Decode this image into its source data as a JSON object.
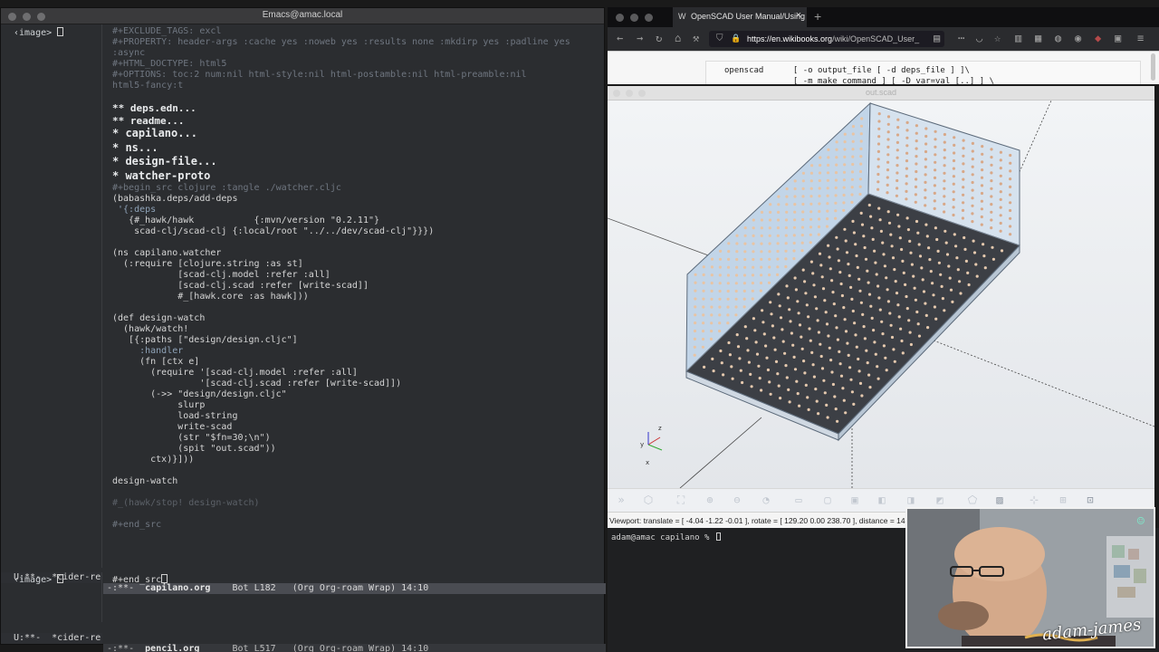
{
  "emacs": {
    "title": "Emacs@amac.local",
    "left_prompt": "‹image>",
    "lower_left_prompt": "‹image>",
    "code_lines": [
      {
        "t": "#+EXCLUDE_TAGS: excl",
        "c": "c-com"
      },
      {
        "t": "#+PROPERTY: header-args :cache yes :noweb yes :results none :mkdirp yes :padline yes",
        "c": "c-com"
      },
      {
        "t": ":async",
        "c": "c-com"
      },
      {
        "t": "#+HTML_DOCTYPE: html5",
        "c": "c-com"
      },
      {
        "t": "#+OPTIONS: toc:2 num:nil html-style:nil html-postamble:nil html-preamble:nil",
        "c": "c-com"
      },
      {
        "t": "html5-fancy:t",
        "c": "c-com"
      },
      {
        "t": "",
        "c": ""
      },
      {
        "t": "** deps.edn...",
        "c": "c-head2"
      },
      {
        "t": "** readme...",
        "c": "c-head2"
      },
      {
        "t": "* capilano...",
        "c": "c-head"
      },
      {
        "t": "* ns...",
        "c": "c-head"
      },
      {
        "t": "* design-file...",
        "c": "c-head"
      },
      {
        "t": "* watcher-proto",
        "c": "c-head"
      },
      {
        "t": "#+begin_src clojure :tangle ./watcher.cljc",
        "c": "c-com"
      },
      {
        "t": "(babashka.deps/add-deps",
        "c": ""
      },
      {
        "t": " '{:deps",
        "c": "c-kw"
      },
      {
        "t": "   {#_hawk/hawk           {:mvn/version \"0.2.11\"}",
        "c": ""
      },
      {
        "t": "    scad-clj/scad-clj {:local/root \"../../dev/scad-clj\"}}})",
        "c": ""
      },
      {
        "t": "",
        "c": ""
      },
      {
        "t": "(ns capilano.watcher",
        "c": ""
      },
      {
        "t": "  (:require [clojure.string :as st]",
        "c": ""
      },
      {
        "t": "            [scad-clj.model :refer :all]",
        "c": ""
      },
      {
        "t": "            [scad-clj.scad :refer [write-scad]]",
        "c": ""
      },
      {
        "t": "            #_[hawk.core :as hawk]))",
        "c": ""
      },
      {
        "t": "",
        "c": ""
      },
      {
        "t": "(def design-watch",
        "c": ""
      },
      {
        "t": "  (hawk/watch!",
        "c": ""
      },
      {
        "t": "   [{:paths [\"design/design.cljc\"]",
        "c": ""
      },
      {
        "t": "     :handler",
        "c": "c-kw"
      },
      {
        "t": "     (fn [ctx e]",
        "c": ""
      },
      {
        "t": "       (require '[scad-clj.model :refer :all]",
        "c": ""
      },
      {
        "t": "                '[scad-clj.scad :refer [write-scad]])",
        "c": ""
      },
      {
        "t": "       (->> \"design/design.cljc\"",
        "c": ""
      },
      {
        "t": "            slurp",
        "c": ""
      },
      {
        "t": "            load-string",
        "c": ""
      },
      {
        "t": "            write-scad",
        "c": ""
      },
      {
        "t": "            (str \"$fn=30;\\n\")",
        "c": ""
      },
      {
        "t": "            (spit \"out.scad\"))",
        "c": ""
      },
      {
        "t": "       ctx)}]))",
        "c": ""
      },
      {
        "t": "",
        "c": ""
      },
      {
        "t": "design-watch",
        "c": ""
      },
      {
        "t": "",
        "c": ""
      },
      {
        "t": "#_(hawk/stop! design-watch)",
        "c": "c-dim"
      },
      {
        "t": "",
        "c": ""
      },
      {
        "t": "#+end_src",
        "c": "c-com"
      }
    ],
    "modeline1": {
      "left": "U:**-  *cider-re",
      "status": "-:**-  ",
      "buffer": "capilano.org",
      "rest": "    Bot L182   (Org Org-roam Wrap) 14:10"
    },
    "modeline2": {
      "left": "U:**-  *cider-re",
      "status": "-:**-  ",
      "buffer": "pencil.org",
      "rest": "      Bot L517   (Org Org-roam Wrap) 14:10"
    },
    "lower_code": "#+end_src"
  },
  "firefox": {
    "tab_title": "OpenSCAD User Manual/Using",
    "url_host": "https://en.wikibooks.org",
    "url_path": "/wiki/OpenSCAD_User_",
    "page_line1": "openscad      [ -o output_file [ -d deps_file ] ]\\",
    "page_line2": "              [ -m make_command ] [ -D var=val [..] ] \\"
  },
  "openscad": {
    "title": "out.scad",
    "status": "Viewport: translate = [ -4.04 -1.22 -0.01 ], rotate = [ 129.20 0.00 238.70 ], distance = 140.00"
  },
  "terminal": {
    "prompt": "adam@amac capilano % "
  },
  "webcam": {
    "signature": "adam-james"
  },
  "colors": {
    "emacs_bg": "#2b2d30",
    "modeline_active": "#4a4c52",
    "tray_face": "#e5c9ae",
    "wall_face": "#c2d5e8"
  }
}
